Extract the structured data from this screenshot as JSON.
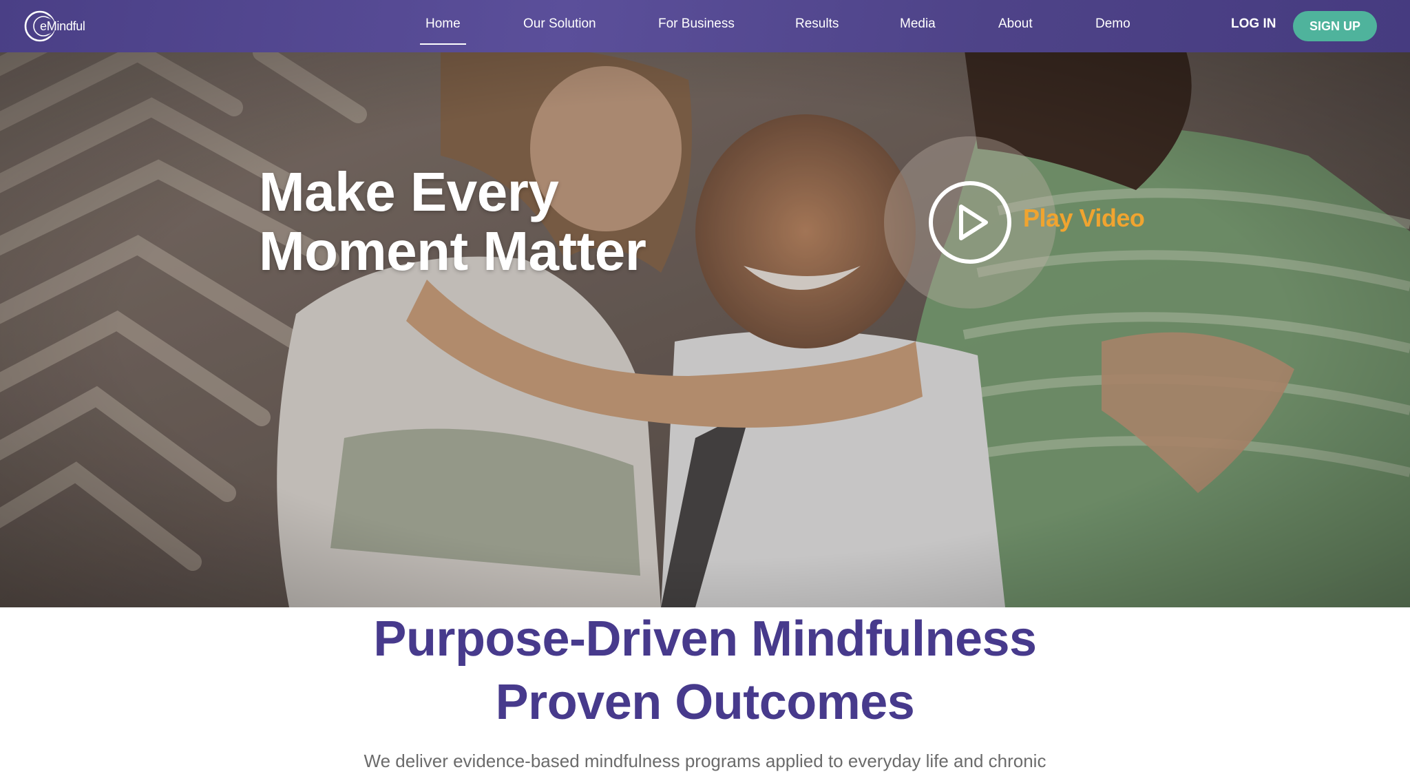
{
  "brand": {
    "name": "eMindful",
    "accent": "#4a3f86",
    "cta_color": "#4fb39c",
    "heading_color": "#473a8c",
    "play_label_color": "#f0a430"
  },
  "nav": {
    "items": [
      {
        "label": "Home",
        "active": true
      },
      {
        "label": "Our Solution",
        "active": false
      },
      {
        "label": "For Business",
        "active": false
      },
      {
        "label": "Results",
        "active": false
      },
      {
        "label": "Media",
        "active": false
      },
      {
        "label": "About",
        "active": false
      },
      {
        "label": "Demo",
        "active": false
      }
    ],
    "login_label": "LOG IN",
    "signup_label": "SIGN UP"
  },
  "hero": {
    "title_lines": [
      "Make Every",
      "Moment Matter"
    ],
    "play_icon": "play-circle-icon",
    "play_label": "Play Video"
  },
  "section": {
    "title_lines": [
      "Purpose-Driven Mindfulness",
      "Proven Outcomes"
    ],
    "description": "We deliver evidence-based mindfulness programs applied to everyday life and chronic"
  }
}
